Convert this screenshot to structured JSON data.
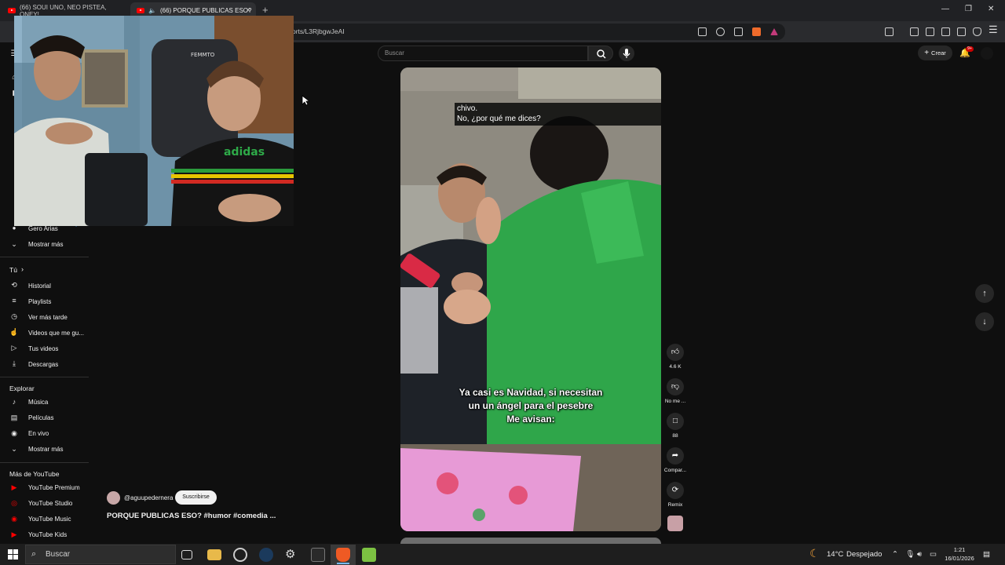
{
  "browser": {
    "tabs": [
      {
        "label": "(66) SOUI UNO, NEO PISTEA, ONEY!"
      },
      {
        "label": "(66) PORQUE PUBLICAS ESO?"
      }
    ],
    "url": "orts/L3RjbgwJeAI"
  },
  "header": {
    "search_placeholder": "Buscar",
    "create_label": "Crear",
    "notif_count": "9+"
  },
  "sidebar": {
    "subs_last": "Gero Arias",
    "show_more_1": "Mostrar más",
    "you_heading": "Tú",
    "you_items": [
      "Historial",
      "Playlists",
      "Ver más tarde",
      "Videos que me gu...",
      "Tus videos",
      "Descargas"
    ],
    "explore_heading": "Explorar",
    "explore_items": [
      "Música",
      "Películas",
      "En vivo"
    ],
    "show_more_2": "Mostrar más",
    "more_heading": "Más de YouTube",
    "more_items": [
      "YouTube Premium",
      "YouTube Studio",
      "YouTube Music",
      "YouTube Kids"
    ]
  },
  "video": {
    "subtitle_line1": "chivo.",
    "subtitle_line2": "No, ¿por qué me dices?",
    "caption_line1": "Ya casi es Navidad, si necesitan",
    "caption_line2": "un un ángel para el pesebre",
    "caption_line3": "Me avisan:",
    "webcam_shirt_text": "adidas",
    "webcam_chair_text": "FEMMTO"
  },
  "actions": {
    "like_count": "4.6 K",
    "dislike_label": "No me ...",
    "comments_count": "88",
    "share_label": "Compar...",
    "remix_label": "Remix"
  },
  "channel": {
    "handle": "@aguupedernera",
    "subscribe_label": "Suscribirse",
    "title": "PORQUE PUBLICAS ESO? #humor #comedia ..."
  },
  "taskbar": {
    "search_label": "Buscar",
    "weather_temp": "14°C",
    "weather_text": "Despejado",
    "time": "1:21",
    "date": "16/01/2026"
  }
}
